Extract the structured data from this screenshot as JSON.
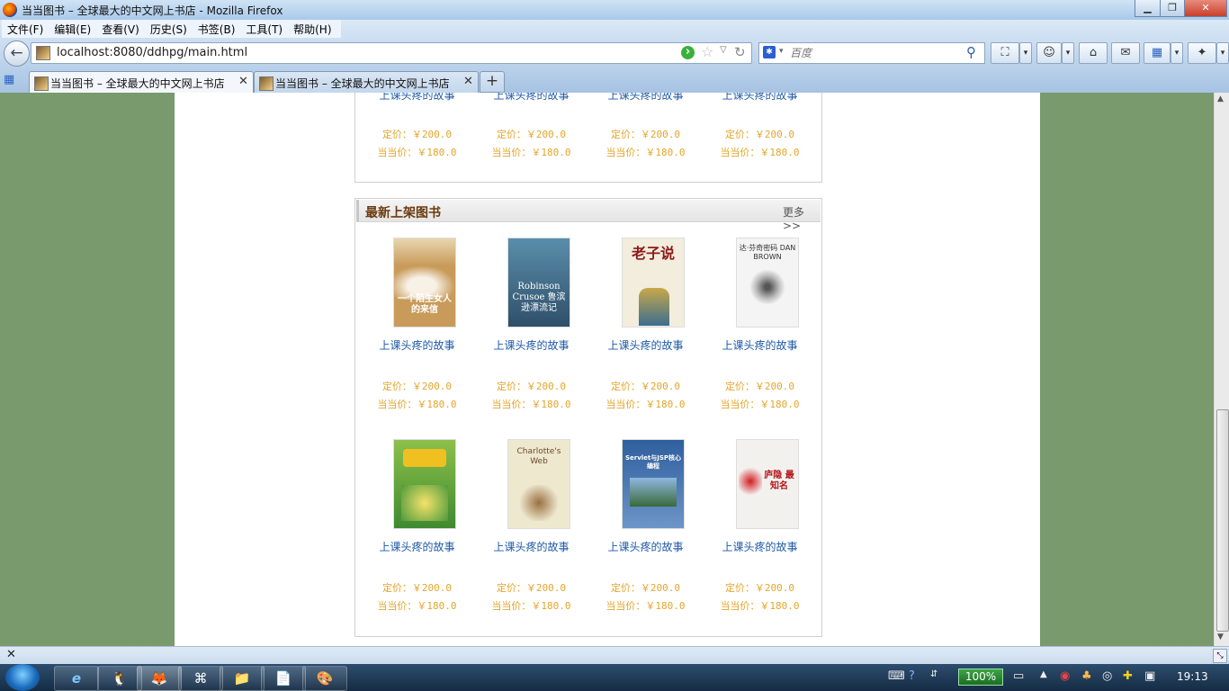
{
  "window": {
    "title": "当当图书 – 全球最大的中文网上书店 - Mozilla Firefox",
    "buttons": [
      "▁",
      "❐",
      "✕"
    ]
  },
  "menu": [
    "文件(F)",
    "编辑(E)",
    "查看(V)",
    "历史(S)",
    "书签(B)",
    "工具(T)",
    "帮助(H)"
  ],
  "nav": {
    "back_icon": "←",
    "url": "localhost:8080/ddhpg/main.html",
    "search_placeholder": "百度",
    "engine_icon": "✱",
    "search_icon": "⚲"
  },
  "tabs": [
    {
      "label": "当当图书 – 全球最大的中文网上书店",
      "active": true
    },
    {
      "label": "当当图书 – 全球最大的中文网上书店",
      "active": false
    }
  ],
  "new_tab_icon": "+",
  "top_section": {
    "items": [
      {
        "name": "上课头疼的故事",
        "list_price": "定价：￥200.0",
        "dd_price": "当当价：￥180.0"
      },
      {
        "name": "上课头疼的故事",
        "list_price": "定价：￥200.0",
        "dd_price": "当当价：￥180.0"
      },
      {
        "name": "上课头疼的故事",
        "list_price": "定价：￥200.0",
        "dd_price": "当当价：￥180.0"
      },
      {
        "name": "上课头疼的故事",
        "list_price": "定价：￥200.0",
        "dd_price": "当当价：￥180.0"
      }
    ]
  },
  "new_books": {
    "title": "最新上架图书",
    "more": "更多>>",
    "items": [
      {
        "name": "上课头疼的故事",
        "list_price": "定价：￥200.0",
        "dd_price": "当当价：￥180.0",
        "cover": {
          "top_text": "",
          "text": "一个陌生女人的来信",
          "bg": "#c89b5a",
          "fg": "#ffffff"
        }
      },
      {
        "name": "上课头疼的故事",
        "list_price": "定价：￥200.0",
        "dd_price": "当当价：￥180.0",
        "cover": {
          "top_text": "",
          "text": "Robinson Crusoe 鲁滨逊漂流记",
          "bg": "#3f6f8f",
          "fg": "#ffffff"
        }
      },
      {
        "name": "上课头疼的故事",
        "list_price": "定价：￥200.0",
        "dd_price": "当当价：￥180.0",
        "cover": {
          "top_text": "",
          "text": "老子说",
          "bg": "#f2eddc",
          "fg": "#8b1a1a"
        }
      },
      {
        "name": "上课头疼的故事",
        "list_price": "定价：￥200.0",
        "dd_price": "当当价：￥180.0",
        "cover": {
          "top_text": "",
          "text": "达·芬奇密码 DAN BROWN",
          "bg": "#eeeeee",
          "fg": "#333333"
        }
      },
      {
        "name": "上课头疼的故事",
        "list_price": "定价：￥200.0",
        "dd_price": "当当价：￥180.0",
        "cover": {
          "top_text": "",
          "text": "",
          "bg": "#6cab3a",
          "fg": "#ffffff"
        }
      },
      {
        "name": "上课头疼的故事",
        "list_price": "定价：￥200.0",
        "dd_price": "当当价：￥180.0",
        "cover": {
          "top_text": "",
          "text": "Charlotte's Web",
          "bg": "#e9e3c9",
          "fg": "#6b4a2a"
        }
      },
      {
        "name": "上课头疼的故事",
        "list_price": "定价：￥200.0",
        "dd_price": "当当价：￥180.0",
        "cover": {
          "top_text": "",
          "text": "Servlet与JSP核心编程",
          "bg": "#3e6fb0",
          "fg": "#ffffff"
        }
      },
      {
        "name": "上课头疼的故事",
        "list_price": "定价：￥200.0",
        "dd_price": "当当价：￥180.0",
        "cover": {
          "top_text": "",
          "text": "庐隐 最知名",
          "bg": "#f3f1ee",
          "fg": "#b3141a"
        }
      }
    ]
  },
  "statusbar": {
    "close": "✕"
  },
  "taskbar": {
    "apps": [
      "e",
      "🐧",
      "🦊",
      "⌘",
      "📁",
      "📄",
      "🎨"
    ],
    "zoom": "100%",
    "clock": "19:13"
  },
  "colors": {
    "page_bg": "#789a6d",
    "price": "#e4a52b",
    "link": "#1e5aa8",
    "section_title": "#6b3a10"
  }
}
